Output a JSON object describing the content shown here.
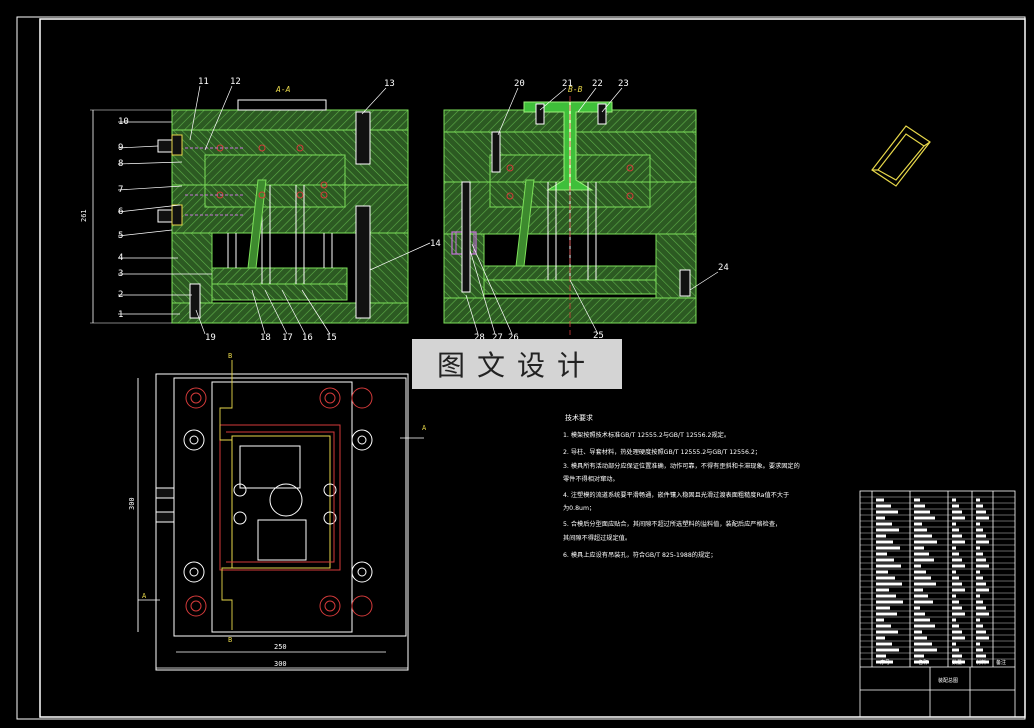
{
  "drawing": {
    "section_a_label": "A-A",
    "section_b_label": "B-B",
    "left_part_numbers": [
      "1",
      "2",
      "3",
      "4",
      "5",
      "6",
      "7",
      "8",
      "9",
      "10"
    ],
    "top_part_numbers": [
      "11",
      "12",
      "13"
    ],
    "bottom_part_numbers_left": [
      "19",
      "18",
      "17",
      "16",
      "15"
    ],
    "part_14": "14",
    "top_part_numbers_right": [
      "20",
      "21",
      "22",
      "23"
    ],
    "part_24": "24",
    "bottom_part_numbers_right": [
      "28",
      "27",
      "26",
      "25"
    ],
    "dim_height": "261",
    "dim_inner_width": "250",
    "dim_outer_width": "300",
    "dim_plan_height": "300",
    "view_marker_a": "A",
    "view_marker_b": "B"
  },
  "watermark": "图文设计",
  "tech_requirements": {
    "title": "技术要求",
    "items": [
      "1. 模架按照技术标准GB/T 12555.2与GB/T 12556.2规定。",
      "2. 导柱、导套材料，热处理硬度按照GB/T 12555.2与GB/T 12556.2；",
      "3. 模具所有活动部分应保证位置准确，动作可靠，不得有歪斜和卡滞现象。要求固定的",
      "   零件不得相对窜动。",
      "4. 注塑模的流道系统要平滑畅通，嵌件镶入稳固且光滑过渡表面粗糙度Ra值不大于",
      "   为0.8um；",
      "5. 合模后分型面应贴合，其间隙不超过所选塑料的溢料值，装配后应严格检查，",
      "   其间隙不得超过规定值。",
      "6. 模具上应设有吊装孔，符合GB/T 825-1988的规定；"
    ]
  },
  "title_block": {
    "name_cell": "装配总图",
    "col_labels": [
      "序号",
      "名称",
      "数量",
      "材料",
      "备注"
    ]
  },
  "colors": {
    "frame": "#ffffff",
    "hatch": "#3d8a2e",
    "outline": "#7de05a",
    "yellow": "#e8d84a",
    "red": "#d33a3a",
    "magenta": "#c470d8",
    "cyan": "#55c6e0"
  }
}
